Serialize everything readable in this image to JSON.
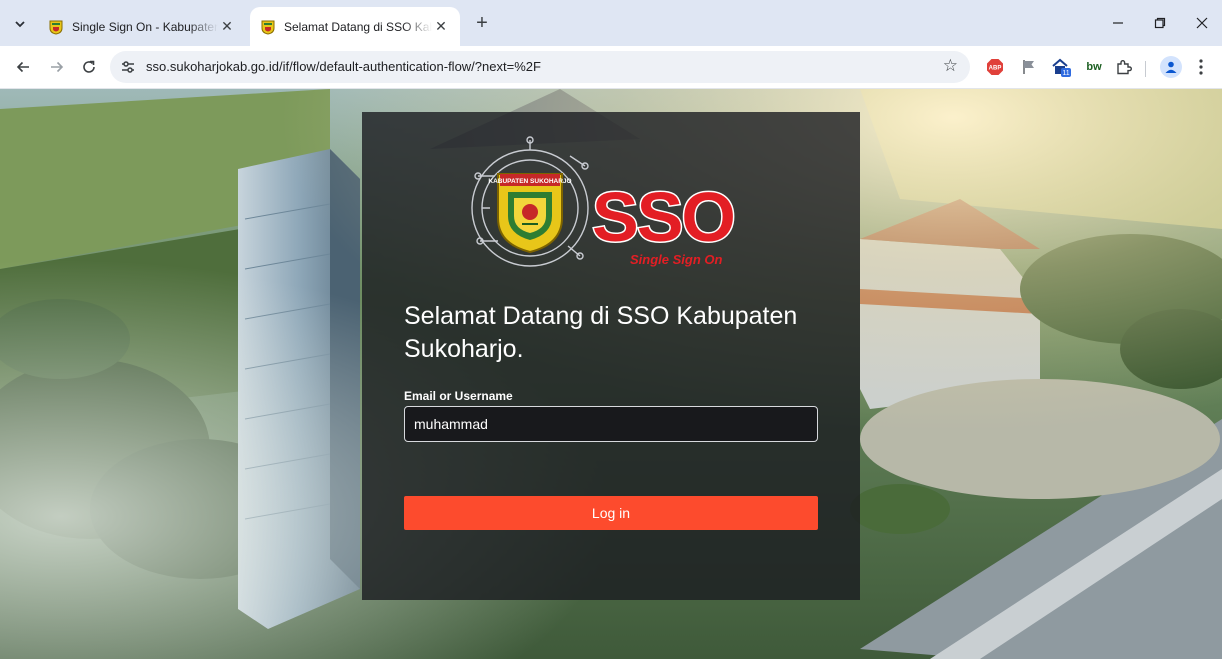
{
  "browser": {
    "tabs": [
      {
        "title": "Single Sign On - Kabupaten Sukoharjo",
        "active": false
      },
      {
        "title": "Selamat Datang di SSO Kabupaten Sukoharjo",
        "active": true
      }
    ],
    "new_tab_symbol": "+",
    "url": "sso.sukoharjokab.go.id/if/flow/default-authentication-flow/?next=%2F",
    "extensions": [
      "abp-icon",
      "flag-icon",
      "home-badge-icon",
      "bw-icon",
      "puzzle-icon"
    ],
    "ext_abp_label": "ABP",
    "ext_home_badge": "11",
    "ext_bw_label": "bw"
  },
  "logo": {
    "text": "SSO",
    "tagline": "Single Sign On",
    "emblem_banner": "KABUPATEN SUKOHARJO"
  },
  "login": {
    "title": "Selamat Datang di SSO Kabupaten Sukoharjo.",
    "field_label": "Email or Username",
    "field_value": "muhammad",
    "button_label": "Log in"
  },
  "colors": {
    "brand_red": "#e31e24",
    "button": "#fd4b2d",
    "card_bg": "rgba(26,28,32,0.80)",
    "tab_strip": "#dfe6f3"
  }
}
